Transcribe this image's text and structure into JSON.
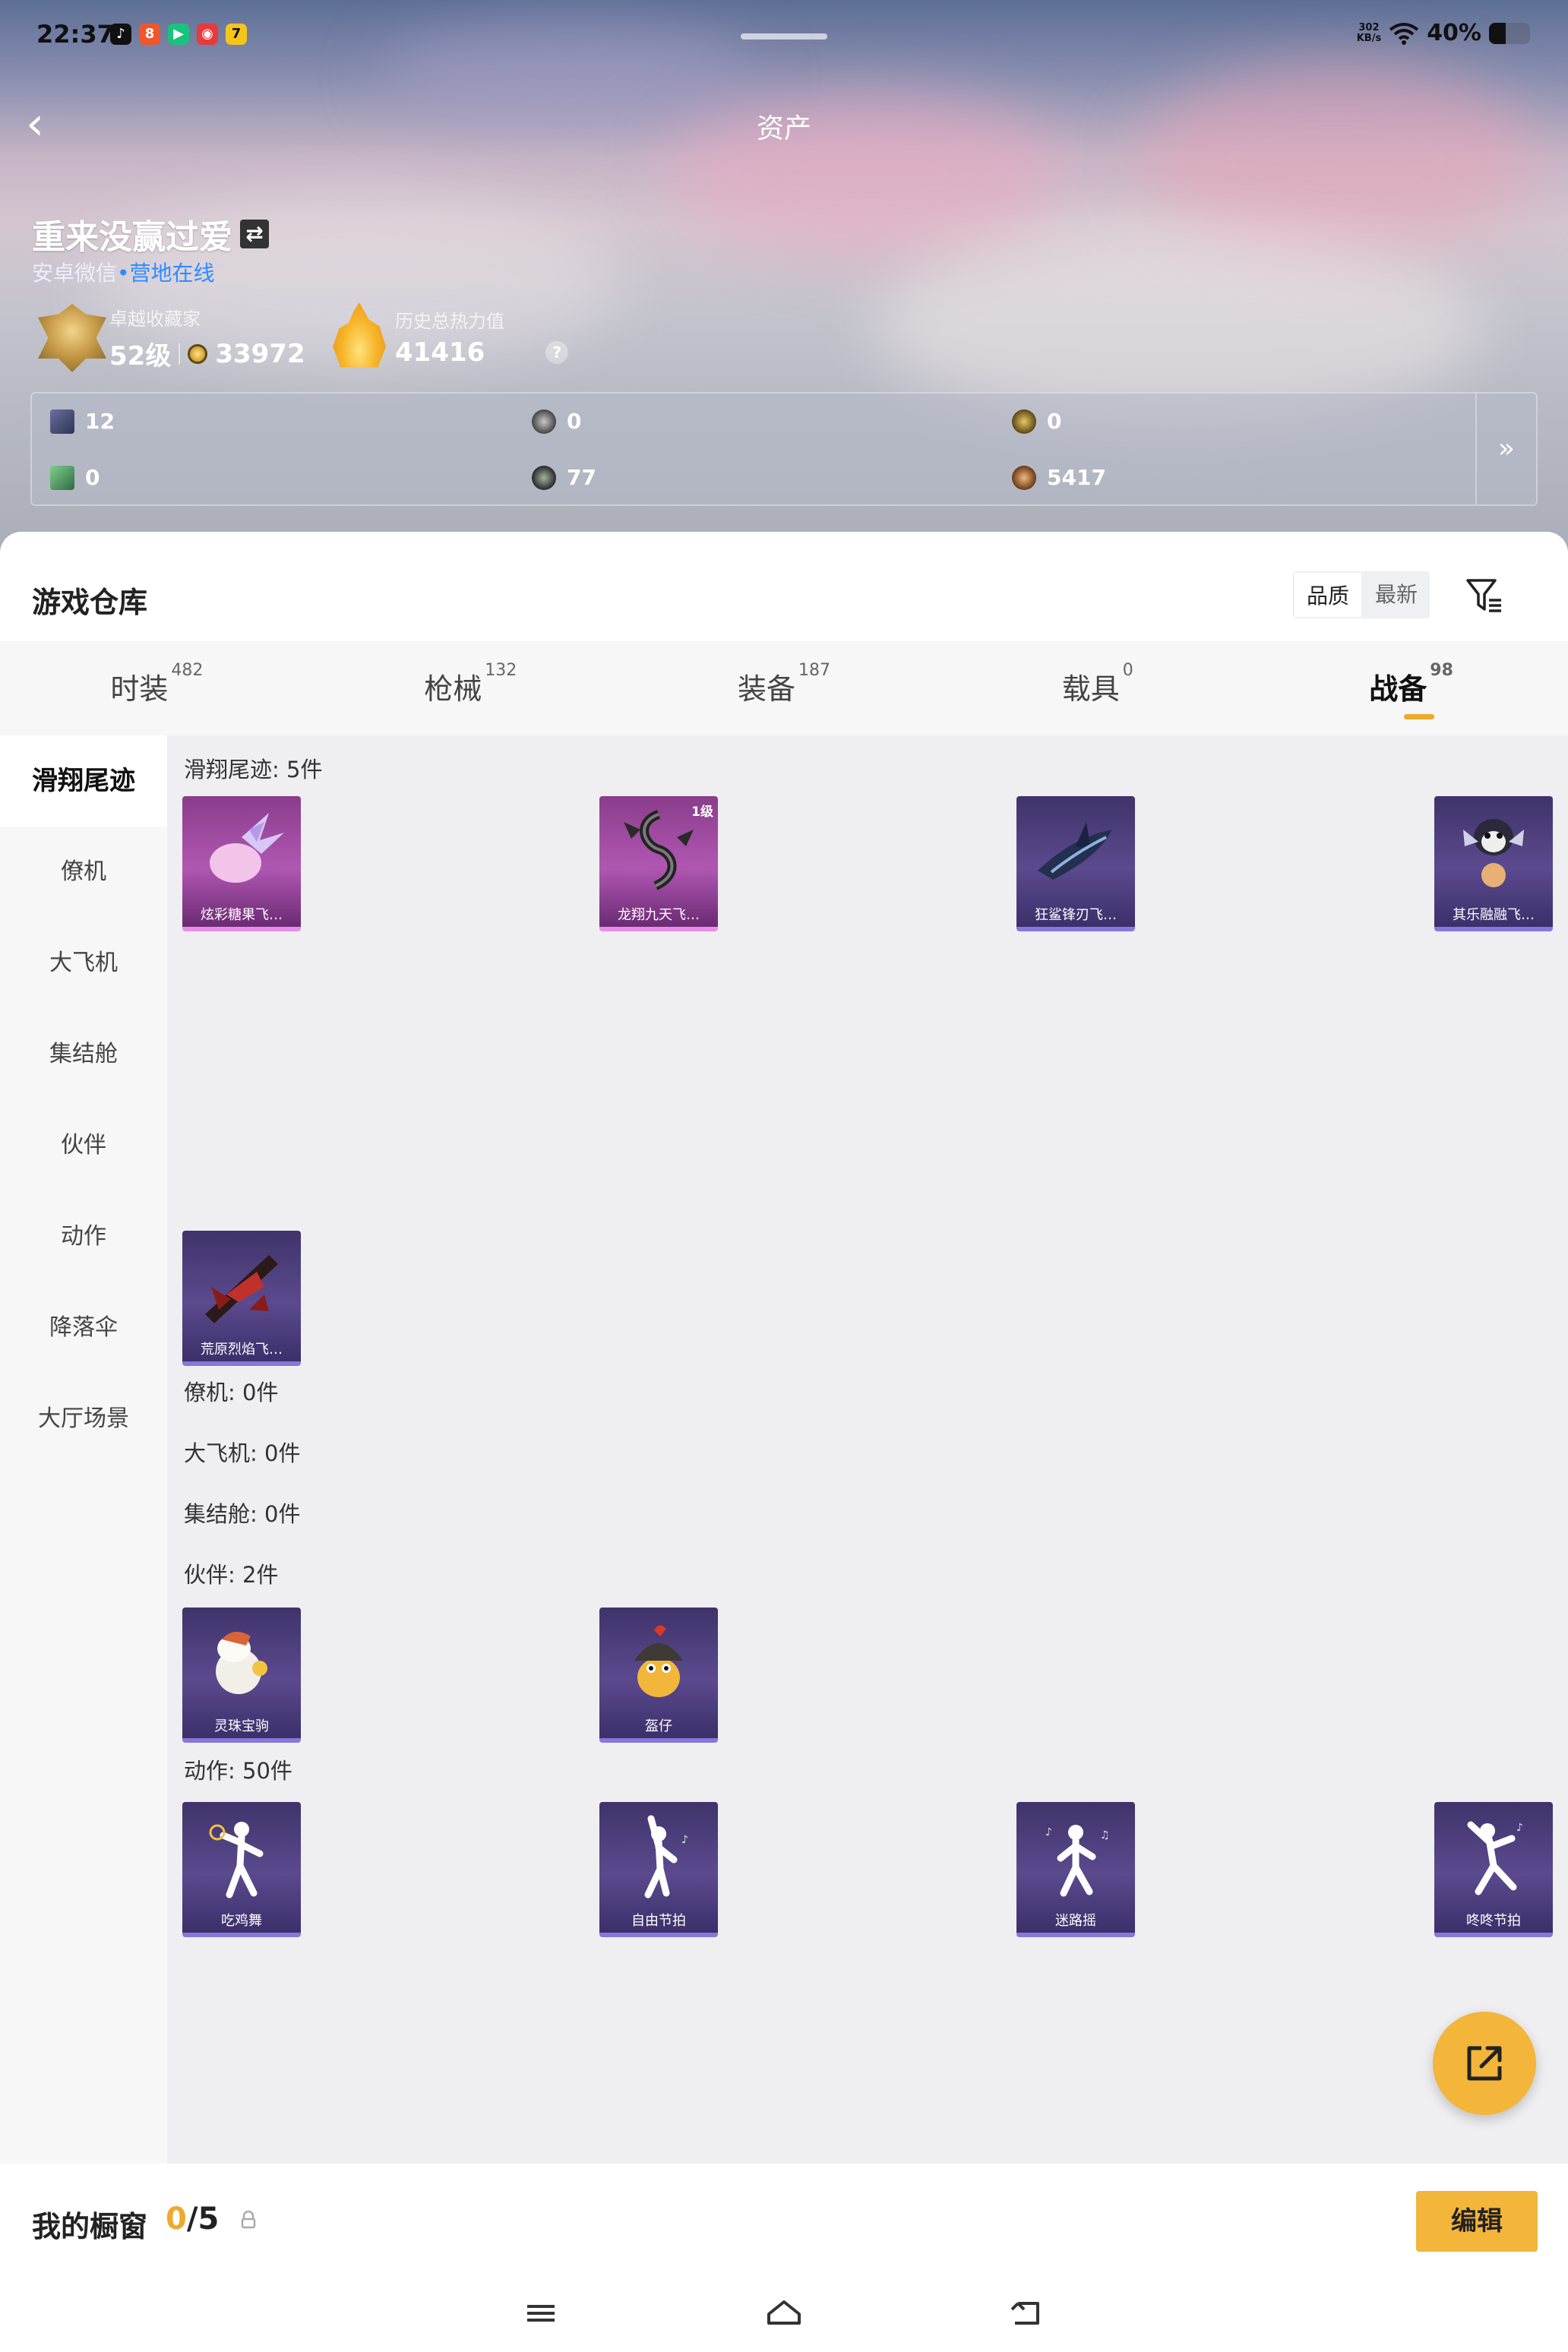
{
  "status_bar": {
    "time": "22:37",
    "net_speed_top": "302",
    "net_speed_bottom": "KB/s",
    "battery": "40%",
    "battery_level": 0.4
  },
  "nav": {
    "title": "资产"
  },
  "profile": {
    "name": "重来没赢过爱",
    "platform": "安卓微信",
    "status": "营地在线",
    "collector_label": "卓越收藏家",
    "level": "52级",
    "coins": "33972",
    "heat_label": "历史总热力值",
    "heat_value": "41416",
    "help": "?"
  },
  "currencies": [
    {
      "icon": "book-icon",
      "value": "12"
    },
    {
      "icon": "grey-coin-icon",
      "value": "0"
    },
    {
      "icon": "gold-coin-icon",
      "value": "0"
    },
    {
      "icon": "leaf-icon",
      "value": "0"
    },
    {
      "icon": "dark-coin-icon",
      "value": "77"
    },
    {
      "icon": "bronze-coin-icon",
      "value": "5417"
    }
  ],
  "warehouse": {
    "title": "游戏仓库",
    "sort_quality": "品质",
    "sort_newest": "最新"
  },
  "tabs": [
    {
      "label": "时装",
      "count": "482"
    },
    {
      "label": "枪械",
      "count": "132"
    },
    {
      "label": "装备",
      "count": "187"
    },
    {
      "label": "载具",
      "count": "0"
    },
    {
      "label": "战备",
      "count": "98"
    }
  ],
  "sidebar": [
    "滑翔尾迹",
    "僚机",
    "大飞机",
    "集结舱",
    "伙伴",
    "动作",
    "降落伞",
    "大厅场景"
  ],
  "sections": {
    "glide": "滑翔尾迹: 5件",
    "wingman": "僚机: 0件",
    "plane": "大飞机: 0件",
    "pod": "集结舱: 0件",
    "partner": "伙伴: 2件",
    "emote": "动作: 50件"
  },
  "items": {
    "glide": [
      {
        "name": "炫彩糖果飞…",
        "level": ""
      },
      {
        "name": "龙翔九天飞…",
        "level": "1级"
      },
      {
        "name": "狂鲨锋刃飞…",
        "level": ""
      },
      {
        "name": "其乐融融飞…",
        "level": ""
      },
      {
        "name": "荒原烈焰飞…",
        "level": ""
      }
    ],
    "partner": [
      {
        "name": "灵珠宝驹"
      },
      {
        "name": "盔仔"
      }
    ],
    "emote": [
      {
        "name": "吃鸡舞"
      },
      {
        "name": "自由节拍"
      },
      {
        "name": "迷路摇"
      },
      {
        "name": "咚咚节拍"
      }
    ]
  },
  "showcase": {
    "title": "我的橱窗",
    "filled": "0",
    "total": "/5",
    "edit": "编辑"
  },
  "colors": {
    "accent": "#f3b53a",
    "online": "#2f8bff",
    "card_purple": "#5b4a8e",
    "card_pink": "#b057b2"
  }
}
